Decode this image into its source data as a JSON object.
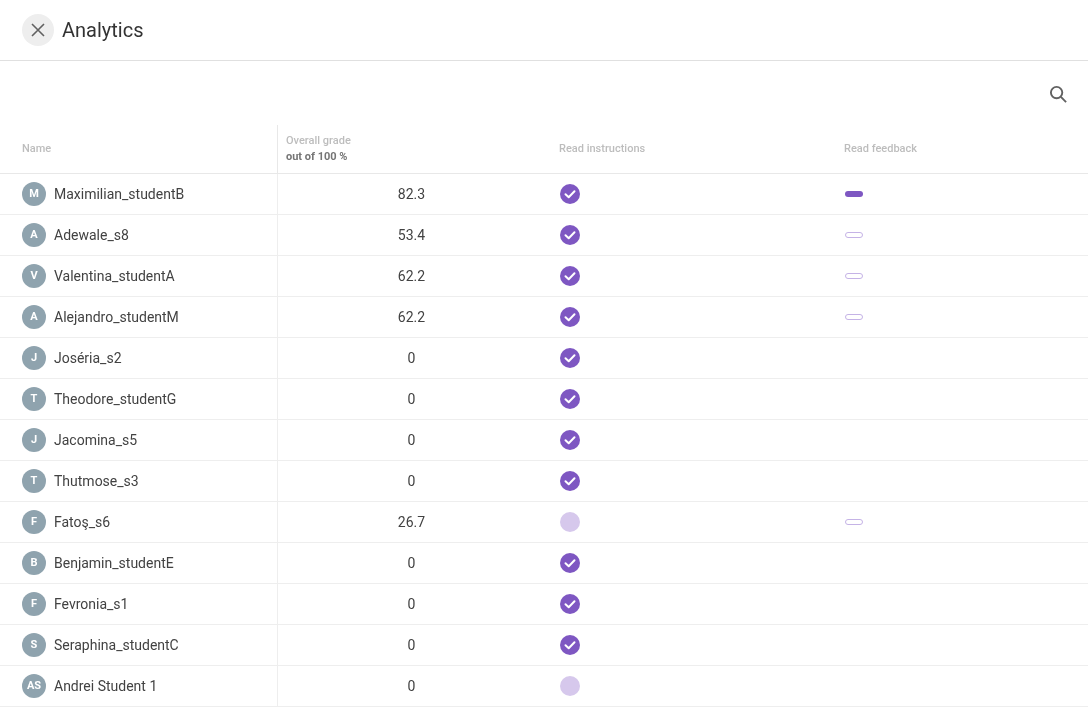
{
  "header": {
    "title": "Analytics"
  },
  "table": {
    "columns": [
      {
        "label": "Name"
      },
      {
        "label": "Overall grade",
        "sublabel": "out of 100 %"
      },
      {
        "label": "Read instructions"
      },
      {
        "label": "Read feedback"
      }
    ],
    "rows": [
      {
        "initials": "M",
        "name": "Maximilian_studentB",
        "grade": "82.3",
        "read_instructions": true,
        "feedback": {
          "read": true
        }
      },
      {
        "initials": "A",
        "name": "Adewale_s8",
        "grade": "53.4",
        "read_instructions": true,
        "feedback": {
          "read": false
        }
      },
      {
        "initials": "V",
        "name": "Valentina_studentA",
        "grade": "62.2",
        "read_instructions": true,
        "feedback": {
          "read": false
        }
      },
      {
        "initials": "A",
        "name": "Alejandro_studentM",
        "grade": "62.2",
        "read_instructions": true,
        "feedback": {
          "read": false
        }
      },
      {
        "initials": "J",
        "name": "Joséria_s2",
        "grade": "0",
        "read_instructions": true
      },
      {
        "initials": "T",
        "name": "Theodore_studentG",
        "grade": "0",
        "read_instructions": true
      },
      {
        "initials": "J",
        "name": "Jacomina_s5",
        "grade": "0",
        "read_instructions": true
      },
      {
        "initials": "T",
        "name": "Thutmose_s3",
        "grade": "0",
        "read_instructions": true
      },
      {
        "initials": "F",
        "name": "Fatoş_s6",
        "grade": "26.7",
        "read_instructions": false,
        "feedback": {
          "read": false
        }
      },
      {
        "initials": "B",
        "name": "Benjamin_studentE",
        "grade": "0",
        "read_instructions": true
      },
      {
        "initials": "F",
        "name": "Fevronia_s1",
        "grade": "0",
        "read_instructions": true
      },
      {
        "initials": "S",
        "name": "Seraphina_studentC",
        "grade": "0",
        "read_instructions": true
      },
      {
        "initials": "AS",
        "name": "Andrei Student 1",
        "grade": "0",
        "read_instructions": false
      }
    ]
  }
}
